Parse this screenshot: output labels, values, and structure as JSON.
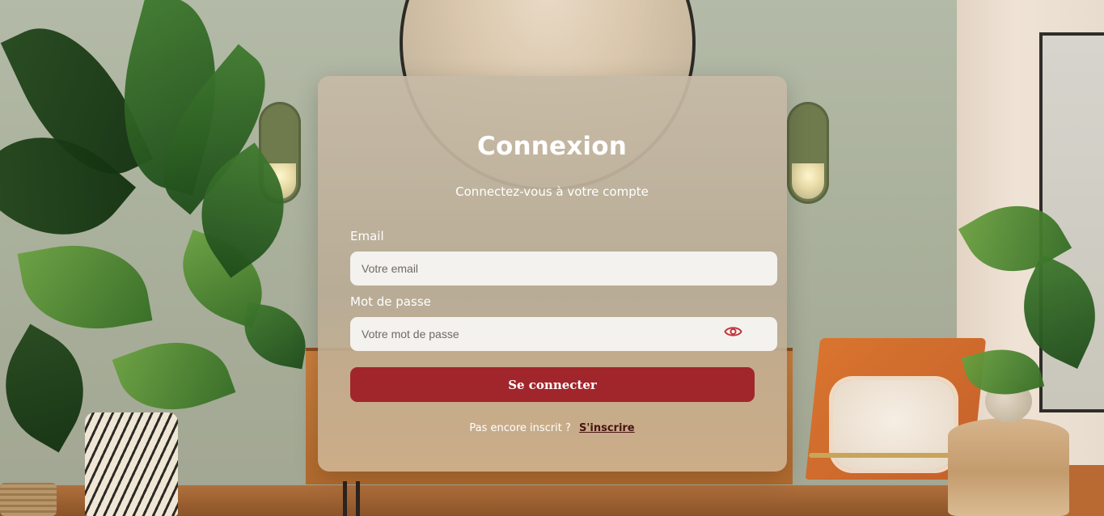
{
  "login": {
    "title": "Connexion",
    "subtitle": "Connectez-vous à votre compte",
    "email_label": "Email",
    "email_placeholder": "Votre email",
    "password_label": "Mot de passe",
    "password_placeholder": "Votre mot de passe",
    "password_toggle_icon": "eye-icon",
    "submit_label": "Se connecter",
    "signup_prompt": "Pas encore inscrit ?",
    "signup_link": "S'inscrire"
  },
  "colors": {
    "submit_button": "#a1262b",
    "eye_icon": "#c0343a",
    "signup_link": "#4a1212",
    "input_background": "#f4f2ee"
  }
}
